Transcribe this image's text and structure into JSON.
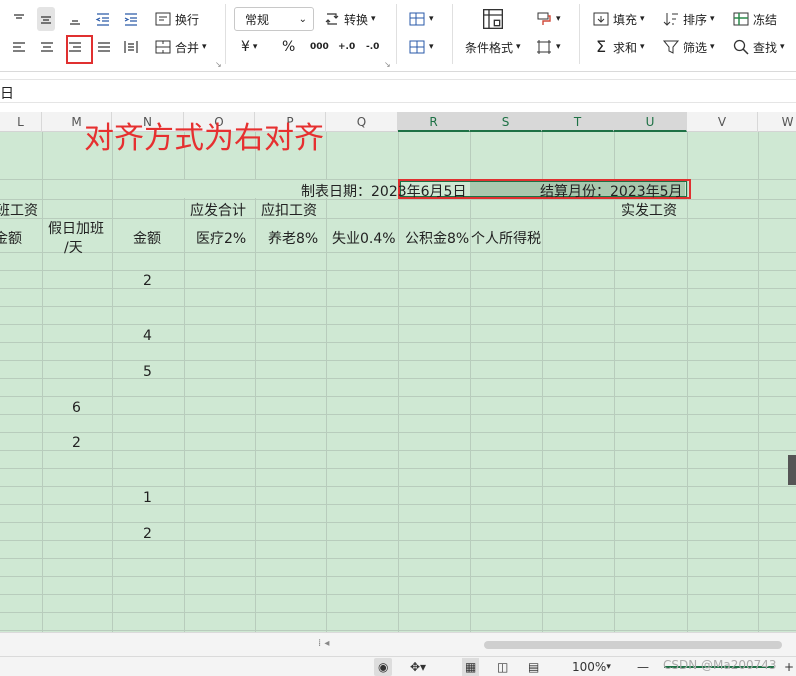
{
  "ribbon": {
    "wrap_label": "换行",
    "merge_label": "合并",
    "number_format": "常规",
    "convert_label": "转换",
    "cond_format_label": "条件格式",
    "fill_label": "填充",
    "sort_label": "排序",
    "freeze_label": "冻结",
    "sum_label": "求和",
    "filter_label": "筛选",
    "find_label": "查找",
    "currency_symbol": "¥",
    "percent_symbol": "%",
    "thousands_symbol": "000",
    "decimal_inc": "+.0",
    "decimal_dec": "-.0"
  },
  "formula_bar": {
    "value": "日"
  },
  "columns": [
    "L",
    "M",
    "N",
    "O",
    "P",
    "Q",
    "R",
    "S",
    "T",
    "U",
    "V",
    "W"
  ],
  "annotation": "对齐方式为右对齐",
  "sheet": {
    "date_label": "制表日期：2023年6月5日",
    "settle_label": "结算月份：2023年5月",
    "overtime_pay_fragment": "班工资",
    "gross_total": "应发合计",
    "deductions": "应扣工资",
    "net_pay": "实发工资",
    "amount_fragment": "金额",
    "holiday_overtime_line1": "假日加班",
    "holiday_overtime_line2": "/天",
    "amount": "金额",
    "medical": "医疗2%",
    "pension": "养老8%",
    "unemployment": "失业0.4%",
    "housing_fund": "公积金8%",
    "income_tax": "个人所得税",
    "m_values": [
      "6",
      "2"
    ],
    "n_values": [
      "2",
      "4",
      "5",
      "1",
      "2"
    ]
  },
  "status": {
    "zoom": "100%",
    "minus": "—",
    "plus": "+"
  },
  "watermark": "CSDN @Ma200743"
}
